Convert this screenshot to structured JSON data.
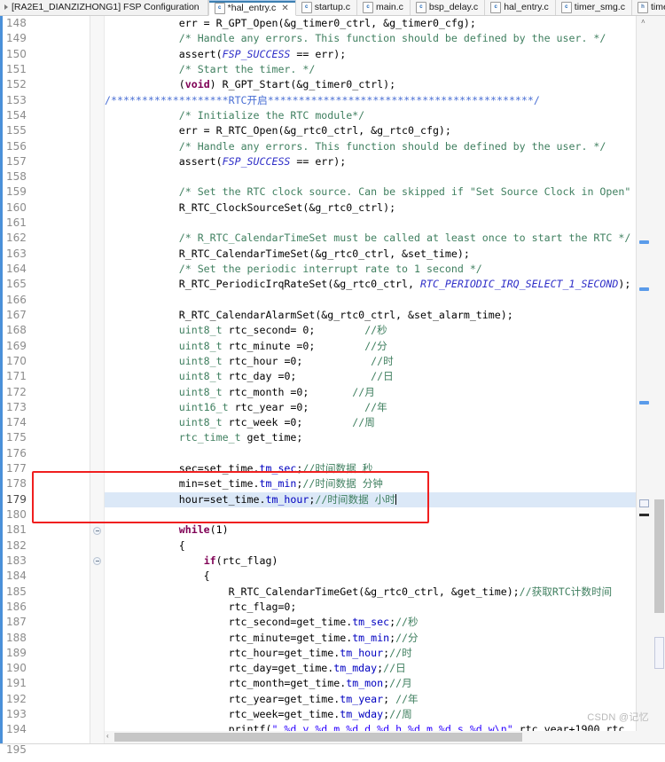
{
  "window": {
    "perspective_label": "[RA2E1_DIANZIZHONG1] FSP Configuration",
    "minimize_icon": "minimize-icon",
    "maximize_icon": "maximize-icon"
  },
  "tabs": [
    {
      "label": "*hal_entry.c",
      "icon": "c-source-file-icon",
      "active": true,
      "closable": true,
      "close_glyph": "✕"
    },
    {
      "label": "startup.c",
      "icon": "c-source-file-icon",
      "active": false,
      "closable": false,
      "close_glyph": ""
    },
    {
      "label": "main.c",
      "icon": "c-source-file-icon",
      "active": false,
      "closable": false,
      "close_glyph": ""
    },
    {
      "label": "bsp_delay.c",
      "icon": "c-source-file-icon",
      "active": false,
      "closable": false,
      "close_glyph": ""
    },
    {
      "label": "hal_entry.c",
      "icon": "c-source-file-icon",
      "active": false,
      "closable": false,
      "close_glyph": ""
    },
    {
      "label": "timer_smg.c",
      "icon": "c-source-file-icon",
      "active": false,
      "closable": false,
      "close_glyph": ""
    },
    {
      "label": "timer_smg.h",
      "icon": "h-header-file-icon",
      "active": false,
      "closable": false,
      "close_glyph": ""
    }
  ],
  "editor": {
    "first_line": 148,
    "last_partial_line": "195",
    "highlighted_line": 179,
    "annotation_box": {
      "color": "#f01f1f",
      "covers_lines": [
        177,
        178,
        179
      ]
    },
    "line_numbers": [
      148,
      149,
      150,
      151,
      152,
      153,
      154,
      155,
      156,
      157,
      158,
      159,
      160,
      161,
      162,
      163,
      164,
      165,
      166,
      167,
      168,
      169,
      170,
      171,
      172,
      173,
      174,
      175,
      176,
      177,
      178,
      179,
      180,
      181,
      182,
      183,
      184,
      185,
      186,
      187,
      188,
      189,
      190,
      191,
      192,
      193,
      194
    ],
    "lines": [
      {
        "n": 148,
        "text": "            err = R_GPT_Open(&g_timer0_ctrl, &g_timer0_cfg);"
      },
      {
        "n": 149,
        "text": "            /* Handle any errors. This function should be defined by the user. */"
      },
      {
        "n": 150,
        "text": "            assert(FSP_SUCCESS == err);"
      },
      {
        "n": 151,
        "text": "            /* Start the timer. */"
      },
      {
        "n": 152,
        "text": "            (void) R_GPT_Start(&g_timer0_ctrl);"
      },
      {
        "n": 153,
        "text": "/*******************RTC开启*******************************************/"
      },
      {
        "n": 154,
        "text": "            /* Initialize the RTC module*/"
      },
      {
        "n": 155,
        "text": "            err = R_RTC_Open(&g_rtc0_ctrl, &g_rtc0_cfg);"
      },
      {
        "n": 156,
        "text": "            /* Handle any errors. This function should be defined by the user. */"
      },
      {
        "n": 157,
        "text": "            assert(FSP_SUCCESS == err);"
      },
      {
        "n": 158,
        "text": ""
      },
      {
        "n": 159,
        "text": "            /* Set the RTC clock source. Can be skipped if \"Set Source Clock in Open\""
      },
      {
        "n": 160,
        "text": "            R_RTC_ClockSourceSet(&g_rtc0_ctrl);"
      },
      {
        "n": 161,
        "text": ""
      },
      {
        "n": 162,
        "text": "            /* R_RTC_CalendarTimeSet must be called at least once to start the RTC */"
      },
      {
        "n": 163,
        "text": "            R_RTC_CalendarTimeSet(&g_rtc0_ctrl, &set_time);"
      },
      {
        "n": 164,
        "text": "            /* Set the periodic interrupt rate to 1 second */"
      },
      {
        "n": 165,
        "text": "            R_RTC_PeriodicIrqRateSet(&g_rtc0_ctrl, RTC_PERIODIC_IRQ_SELECT_1_SECOND);"
      },
      {
        "n": 166,
        "text": ""
      },
      {
        "n": 167,
        "text": "            R_RTC_CalendarAlarmSet(&g_rtc0_ctrl, &set_alarm_time);"
      },
      {
        "n": 168,
        "text": "            uint8_t rtc_second= 0;        //秒"
      },
      {
        "n": 169,
        "text": "            uint8_t rtc_minute =0;        //分"
      },
      {
        "n": 170,
        "text": "            uint8_t rtc_hour =0;           //时"
      },
      {
        "n": 171,
        "text": "            uint8_t rtc_day =0;            //日"
      },
      {
        "n": 172,
        "text": "            uint8_t rtc_month =0;       //月"
      },
      {
        "n": 173,
        "text": "            uint16_t rtc_year =0;         //年"
      },
      {
        "n": 174,
        "text": "            uint8_t rtc_week =0;        //周"
      },
      {
        "n": 175,
        "text": "            rtc_time_t get_time;"
      },
      {
        "n": 176,
        "text": ""
      },
      {
        "n": 177,
        "text": "            sec=set_time.tm_sec;//时间数据 秒"
      },
      {
        "n": 178,
        "text": "            min=set_time.tm_min;//时间数据 分钟"
      },
      {
        "n": 179,
        "text": "            hour=set_time.tm_hour;//时间数据 小时"
      },
      {
        "n": 180,
        "text": ""
      },
      {
        "n": 181,
        "text": "            while(1)"
      },
      {
        "n": 182,
        "text": "            {"
      },
      {
        "n": 183,
        "text": "                if(rtc_flag)"
      },
      {
        "n": 184,
        "text": "                {"
      },
      {
        "n": 185,
        "text": "                    R_RTC_CalendarTimeGet(&g_rtc0_ctrl, &get_time);//获取RTC计数时间"
      },
      {
        "n": 186,
        "text": "                    rtc_flag=0;"
      },
      {
        "n": 187,
        "text": "                    rtc_second=get_time.tm_sec;//秒"
      },
      {
        "n": 188,
        "text": "                    rtc_minute=get_time.tm_min;//分"
      },
      {
        "n": 189,
        "text": "                    rtc_hour=get_time.tm_hour;//时"
      },
      {
        "n": 190,
        "text": "                    rtc_day=get_time.tm_mday;//日"
      },
      {
        "n": 191,
        "text": "                    rtc_month=get_time.tm_mon;//月"
      },
      {
        "n": 192,
        "text": "                    rtc_year=get_time.tm_year; //年"
      },
      {
        "n": 193,
        "text": "                    rtc_week=get_time.tm_wday;//周"
      },
      {
        "n": 194,
        "text": "                    printf(\" %d y %d m %d d %d h %d m %d s %d w\\n\",rtc_year+1900,rtc_"
      }
    ],
    "fold_markers": [
      181,
      183
    ]
  },
  "scrollbars": {
    "vertical_up_arrow": "˄",
    "horizontal_left_arrow": "‹"
  },
  "watermark": "CSDN @记忆",
  "colors": {
    "comment": "#3f7f5f",
    "keyword": "#7f0055",
    "macro": "#2f2fc8",
    "field": "#0000c0",
    "string": "#2a00ff",
    "banner": "#4a6fd4",
    "annotation": "#f01f1f",
    "selection": "#dbe8f7",
    "accent": "#4a90d9"
  }
}
